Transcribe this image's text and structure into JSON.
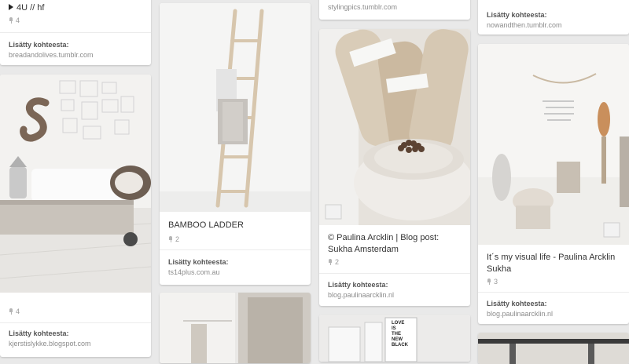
{
  "colors": {
    "background": "#e9e9e9",
    "card": "#ffffff",
    "label": "#555555",
    "host": "#8c8c8c"
  },
  "source_label": "Lisätty kohteesta:",
  "pins": [
    {
      "id": "p1",
      "description": "4U // hf",
      "repins": "4",
      "source": "breadandolives.tumblr.com"
    },
    {
      "id": "p2",
      "description": "",
      "repins": "4",
      "source": "kjerstislykke.blogspot.com"
    },
    {
      "id": "p3",
      "description": "BAMBOO LADDER",
      "repins": "2",
      "source": "ts14plus.com.au"
    },
    {
      "id": "p4",
      "description": "",
      "repins": "",
      "source": "stylingpics.tumblr.com"
    },
    {
      "id": "p5",
      "description": "© Paulina Arcklin | Blog post: Sukha Amsterdam",
      "repins": "2",
      "source": "blog.paulinaarcklin.nl"
    },
    {
      "id": "p6",
      "description": "",
      "repins": "",
      "source": "nowandthen.tumblr.com"
    },
    {
      "id": "p7",
      "description": "It´s my visual life - Paulina Arcklin Sukha",
      "repins": "3",
      "source": "blog.paulinaarcklin.nl"
    }
  ],
  "image_texts": {
    "poster_lines": [
      "LOVE",
      "IS",
      "THE",
      "NEW",
      "BLACK"
    ]
  }
}
